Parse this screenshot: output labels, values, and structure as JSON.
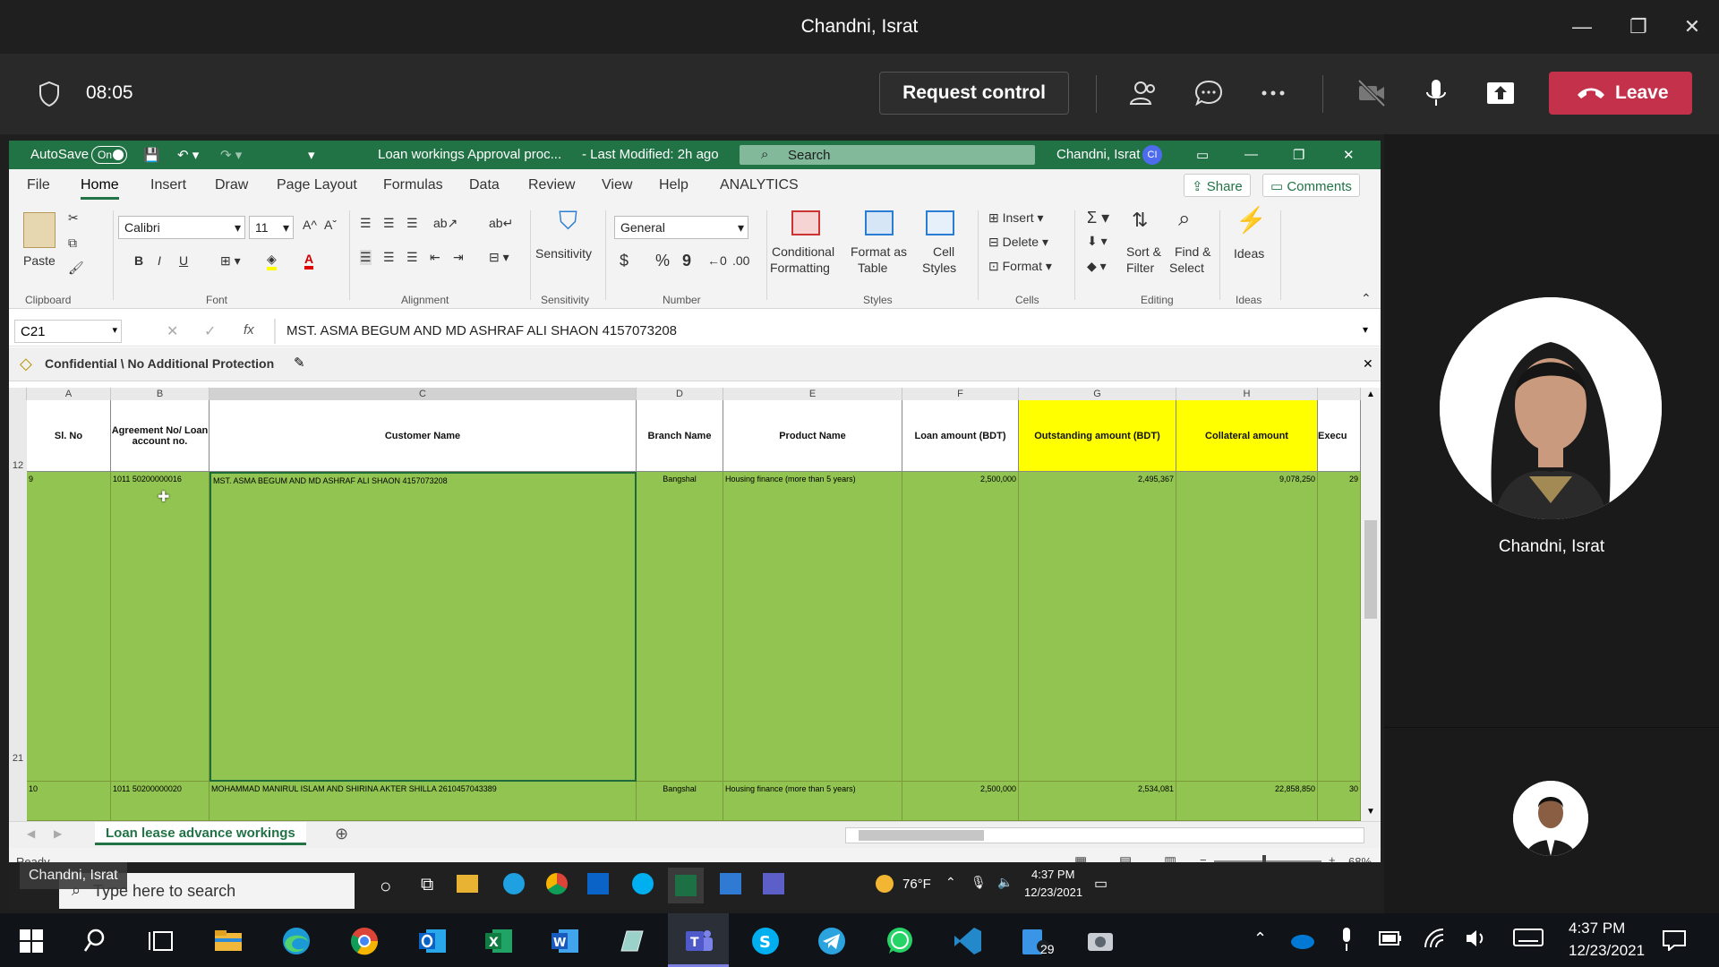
{
  "teams": {
    "window_title": "Chandni, Israt",
    "timer": "08:05",
    "request_control_label": "Request control",
    "leave_label": "Leave",
    "participant_main": "Chandni, Israt"
  },
  "excel": {
    "autosave_label": "AutoSave",
    "autosave_state": "On",
    "doc_title": "Loan workings Approval proc...",
    "last_modified": "-  Last Modified: 2h ago",
    "search_placeholder": "Search",
    "user_name": "Chandni, Israt",
    "user_initials": "CI",
    "menu": [
      "File",
      "Home",
      "Insert",
      "Draw",
      "Page Layout",
      "Formulas",
      "Data",
      "Review",
      "View",
      "Help",
      "ANALYTICS"
    ],
    "share_label": "Share",
    "comments_label": "Comments",
    "ribbon": {
      "paste": "Paste",
      "font_name": "Calibri",
      "font_size": "11",
      "bold": "B",
      "italic": "I",
      "underline": "U",
      "sensitivity": "Sensitivity",
      "number_format": "General",
      "currency": "$",
      "percent": "%",
      "comma": "9",
      "conditional_formatting": [
        "Conditional",
        "Formatting"
      ],
      "format_as_table": [
        "Format as",
        "Table"
      ],
      "cell_styles": [
        "Cell",
        "Styles"
      ],
      "insert": "Insert",
      "delete": "Delete",
      "format": "Format",
      "sort_filter": [
        "Sort &",
        "Filter"
      ],
      "find_select": [
        "Find &",
        "Select"
      ],
      "ideas": "Ideas",
      "groups": [
        "Clipboard",
        "Font",
        "Alignment",
        "Sensitivity",
        "Number",
        "Styles",
        "Cells",
        "Editing",
        "Ideas"
      ]
    },
    "name_box": "C21",
    "fx": "fx",
    "formula": "MST. ASMA BEGUM AND MD ASHRAF ALI SHAON 4157073208",
    "sensitivity_label": "Confidential \\ No Additional Protection",
    "columns": [
      "A",
      "B",
      "C",
      "D",
      "E",
      "F",
      "G",
      "H"
    ],
    "header_row_number": "12",
    "headers": [
      "Sl. No",
      "Agreement No/ Loan account no.",
      "Customer Name",
      "Branch Name",
      "Product Name",
      "Loan amount (BDT)",
      "Outstanding amount (BDT)",
      "Collateral amount",
      "Execu"
    ],
    "rows": [
      {
        "row_number": "21",
        "sl": "9",
        "account": "1011 50200000016",
        "customer": "MST. ASMA BEGUM AND MD ASHRAF ALI SHAON 4157073208",
        "branch": "Bangshal",
        "product": "Housing finance (more than 5 years)",
        "loan": "2,500,000",
        "outstanding": "2,495,367",
        "collateral": "9,078,250",
        "extra": "29"
      },
      {
        "row_number": "",
        "sl": "10",
        "account": "1011 50200000020",
        "customer": "MOHAMMAD MANIRUL ISLAM AND SHIRINA AKTER SHILLA 2610457043389",
        "branch": "Bangshal",
        "product": "Housing finance (more than 5 years)",
        "loan": "2,500,000",
        "outstanding": "2,534,081",
        "collateral": "22,858,850",
        "extra": "30"
      }
    ],
    "sheet_tab": "Loan lease advance workings",
    "status": "Ready",
    "zoom": "68%"
  },
  "inner_taskbar": {
    "presenter_tag": "Chandni, Israt",
    "search_placeholder": "Type here to search",
    "temperature": "76°F",
    "time": "4:37 PM",
    "date": "12/23/2021"
  },
  "taskbar": {
    "time": "4:37 PM",
    "date": "12/23/2021",
    "badge": "29"
  },
  "colors": {
    "excel_green": "#217346",
    "row_green": "#92c451",
    "header_yellow": "#ffff00",
    "leave_red": "#c4314b"
  }
}
